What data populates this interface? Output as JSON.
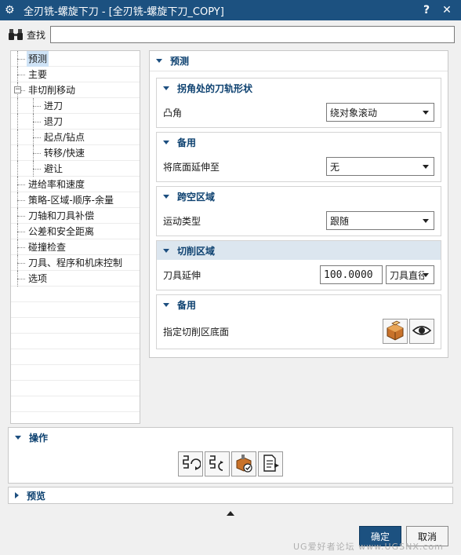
{
  "window": {
    "title": "全刃铣-螺旋下刀 - [全刃铣-螺旋下刀_COPY]",
    "help": "?",
    "close": "✕"
  },
  "search": {
    "label": "查找",
    "value": ""
  },
  "tree": {
    "items": [
      {
        "label": "预测",
        "level": 1,
        "selected": true
      },
      {
        "label": "主要",
        "level": 1
      },
      {
        "label": "非切削移动",
        "level": 1,
        "expander": "−"
      },
      {
        "label": "进刀",
        "level": 2
      },
      {
        "label": "退刀",
        "level": 2
      },
      {
        "label": "起点/钻点",
        "level": 2
      },
      {
        "label": "转移/快速",
        "level": 2
      },
      {
        "label": "避让",
        "level": 2
      },
      {
        "label": "进给率和速度",
        "level": 1
      },
      {
        "label": "策略-区域-顺序-余量",
        "level": 1
      },
      {
        "label": "刀轴和刀具补偿",
        "level": 1
      },
      {
        "label": "公差和安全距离",
        "level": 1
      },
      {
        "label": "碰撞检查",
        "level": 1
      },
      {
        "label": "刀具、程序和机床控制",
        "level": 1
      },
      {
        "label": "选项",
        "level": 1
      }
    ]
  },
  "panel": {
    "title": "预测",
    "groups": {
      "corner": {
        "title": "拐角处的刀轨形状",
        "label": "凸角",
        "value": "绕对象滚动"
      },
      "spare1": {
        "title": "备用",
        "label": "将底面延伸至",
        "value": "无"
      },
      "airgap": {
        "title": "跨空区域",
        "label": "运动类型",
        "value": "跟随"
      },
      "cutregion": {
        "title": "切削区域",
        "label": "刀具延伸",
        "value": "100.0000",
        "unit": "刀具直径"
      },
      "spare2": {
        "title": "备用",
        "label": "指定切削区底面"
      }
    }
  },
  "operations": {
    "title": "操作"
  },
  "preview": {
    "title": "预览"
  },
  "buttons": {
    "ok": "确定",
    "cancel": "取消"
  },
  "watermark": "UG爱好者论坛 www.UGSNX.com"
}
